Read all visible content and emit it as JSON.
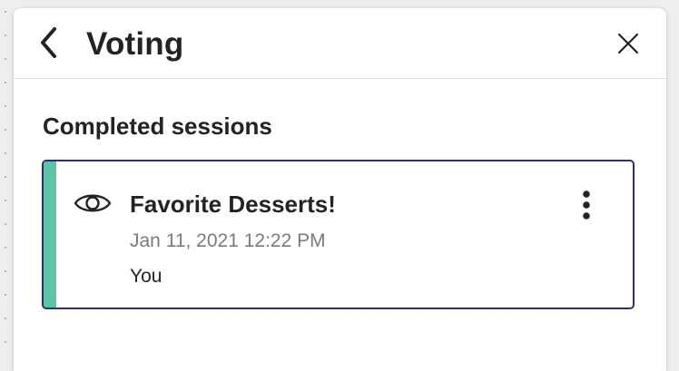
{
  "header": {
    "title": "Voting"
  },
  "section": {
    "title": "Completed sessions"
  },
  "sessions": [
    {
      "title": "Favorite Desserts!",
      "date": "Jan 11, 2021 12:22 PM",
      "owner": "You"
    }
  ],
  "colors": {
    "accent": "#5cc3a5",
    "card_border": "#2b2f7c",
    "text": "#232325",
    "muted_text": "#7a7a80"
  },
  "icons": {
    "back": "chevron-left-icon",
    "close": "close-icon",
    "view": "eye-icon",
    "menu": "more-vertical-icon"
  }
}
